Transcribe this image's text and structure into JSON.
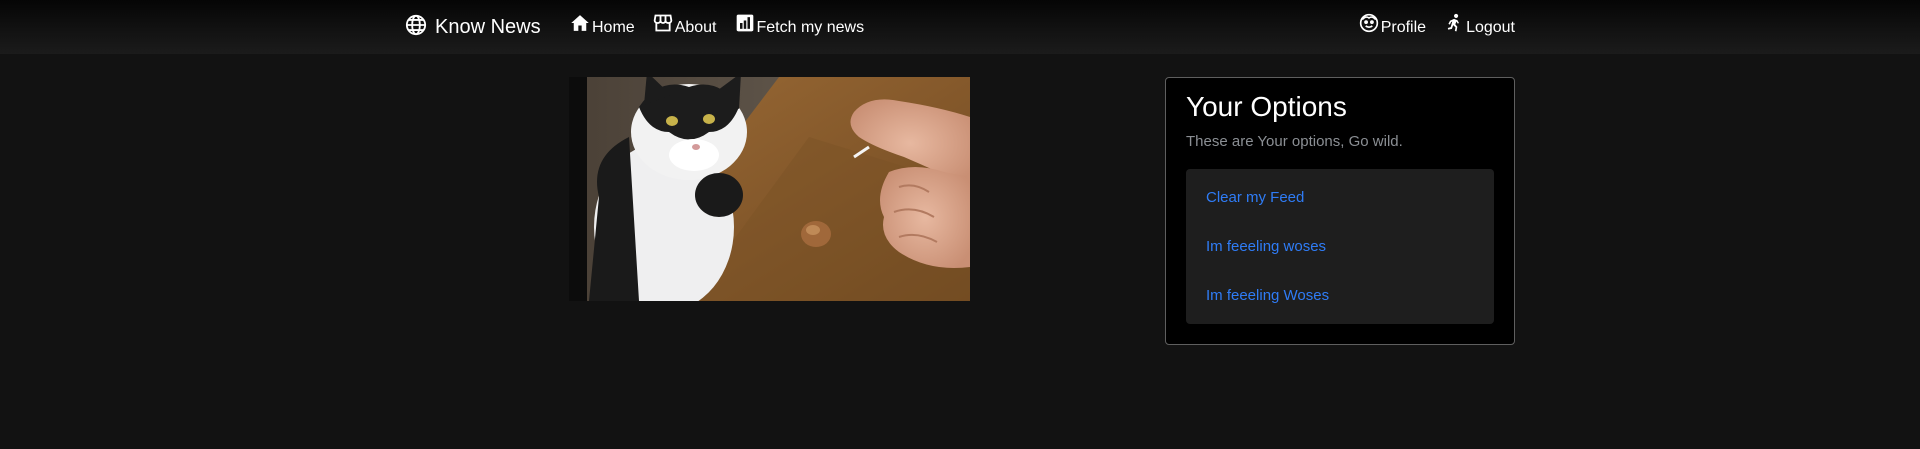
{
  "navbar": {
    "brand": {
      "label": "Know News",
      "icon": "globe-icon"
    },
    "links": [
      {
        "label": "Home",
        "icon": "home-icon"
      },
      {
        "label": "About",
        "icon": "store-icon"
      },
      {
        "label": "Fetch my news",
        "icon": "bar-chart-icon"
      }
    ],
    "right_links": [
      {
        "label": "Profile",
        "icon": "smiley-icon"
      },
      {
        "label": " Logout",
        "icon": "running-person-icon"
      }
    ]
  },
  "main": {
    "media": {
      "description_icon": "cat-gif-image"
    }
  },
  "options_card": {
    "title": "Your Options",
    "subtitle": "These are Your options, Go wild.",
    "items": [
      {
        "label": "Clear my Feed"
      },
      {
        "label": "Im feeeling woses"
      },
      {
        "label": "Im feeeling Woses"
      }
    ]
  },
  "colors": {
    "background": "#121212",
    "card_background": "#000000",
    "list_background": "#1e1e1e",
    "link": "#2f7cf6",
    "muted_text": "#8b8f94"
  }
}
